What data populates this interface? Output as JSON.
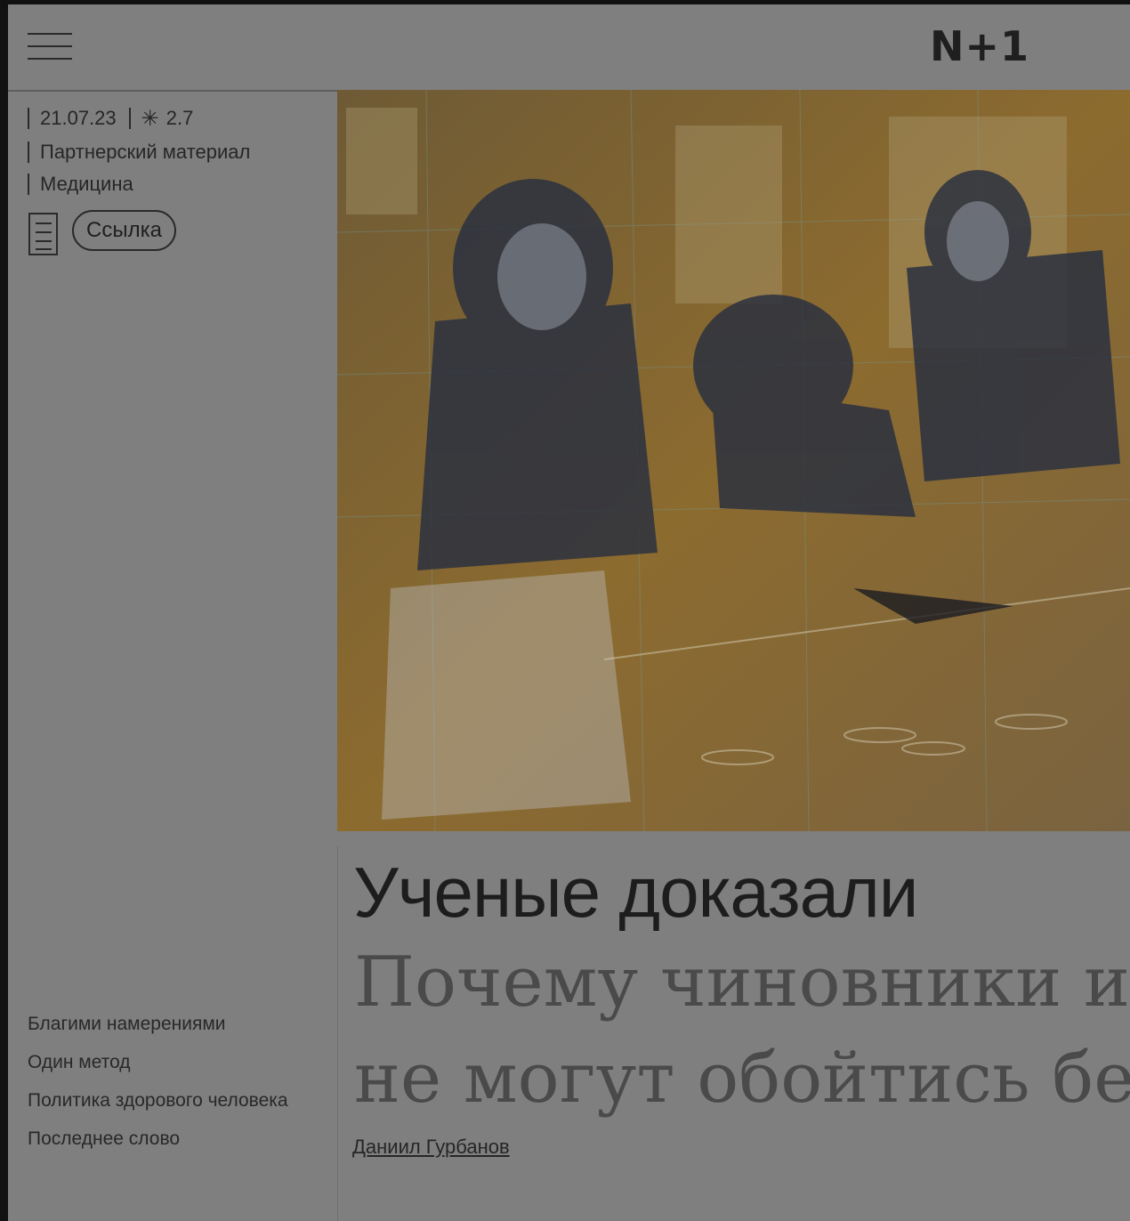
{
  "header": {
    "logo": "N+1"
  },
  "meta": {
    "date": "21.07.23",
    "difficulty": "2.7",
    "badge": "Партнерский материал",
    "category": "Медицина",
    "link_label": "Ссылка"
  },
  "toc": [
    "Благими намерениями",
    "Один метод",
    "Политика здорового человека",
    "Последнее слово"
  ],
  "article": {
    "headline": "Ученые доказали",
    "subheadline": "Почему чиновники и\nне могут обойтись бе",
    "author": "Даниил Гурбанов"
  }
}
